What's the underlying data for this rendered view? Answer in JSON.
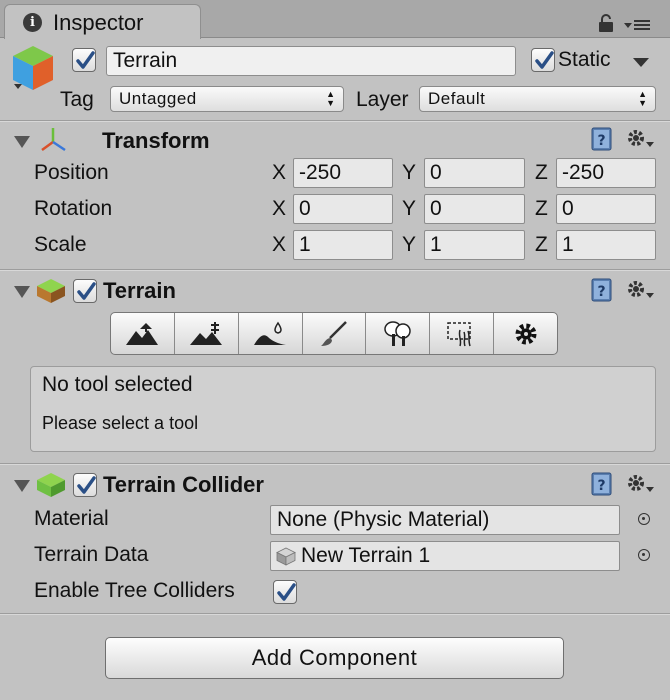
{
  "tab": {
    "title": "Inspector",
    "icon": "info-icon"
  },
  "header": {
    "object_name": "Terrain",
    "active": true,
    "static_label": "Static",
    "static_checked": true,
    "tag_label": "Tag",
    "tag_value": "Untagged",
    "layer_label": "Layer",
    "layer_value": "Default"
  },
  "transform": {
    "title": "Transform",
    "rows": [
      {
        "label": "Position",
        "x": "-250",
        "y": "0",
        "z": "-250"
      },
      {
        "label": "Rotation",
        "x": "0",
        "y": "0",
        "z": "0"
      },
      {
        "label": "Scale",
        "x": "1",
        "y": "1",
        "z": "1"
      }
    ],
    "axis": {
      "x": "X",
      "y": "Y",
      "z": "Z"
    }
  },
  "terrain": {
    "title": "Terrain",
    "enabled": true,
    "tools": [
      "raise-lower-icon",
      "paint-height-icon",
      "smooth-height-icon",
      "paint-texture-icon",
      "place-trees-icon",
      "paint-details-icon",
      "settings-icon"
    ],
    "help_title": "No tool selected",
    "help_text": "Please select a tool"
  },
  "terrain_collider": {
    "title": "Terrain Collider",
    "enabled": true,
    "material_label": "Material",
    "material_value": "None (Physic Material)",
    "terrain_data_label": "Terrain Data",
    "terrain_data_value": "New Terrain 1",
    "tree_colliders_label": "Enable Tree Colliders",
    "tree_colliders_checked": true
  },
  "add_component_label": "Add Component",
  "colors": {
    "panel": "#c2c2c2",
    "tab_bar": "#a8a8a8",
    "check": "#2a4f86"
  }
}
